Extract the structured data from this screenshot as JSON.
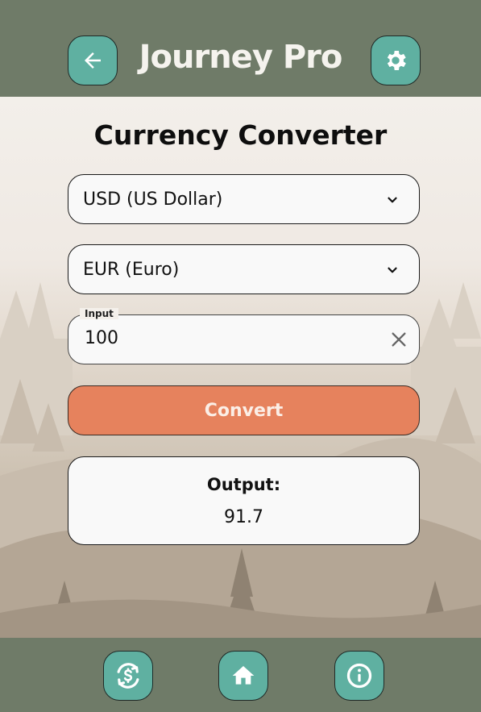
{
  "header": {
    "title": "Journey Pro",
    "back_icon": "arrow-left-icon",
    "settings_icon": "gear-icon"
  },
  "main": {
    "title": "Currency Converter",
    "from_currency": "USD (US Dollar)",
    "to_currency": "EUR (Euro)",
    "input_label": "Input",
    "input_value": "100",
    "convert_label": "Convert",
    "output_label": "Output:",
    "output_value": "91.7"
  },
  "footer": {
    "items": [
      {
        "icon": "currency-exchange-icon"
      },
      {
        "icon": "home-icon"
      },
      {
        "icon": "info-icon"
      }
    ]
  },
  "colors": {
    "bar": "#6f7b68",
    "button_teal": "#5fb0a1",
    "convert_orange": "#e6825d",
    "card_bg": "#f9f9f9"
  }
}
